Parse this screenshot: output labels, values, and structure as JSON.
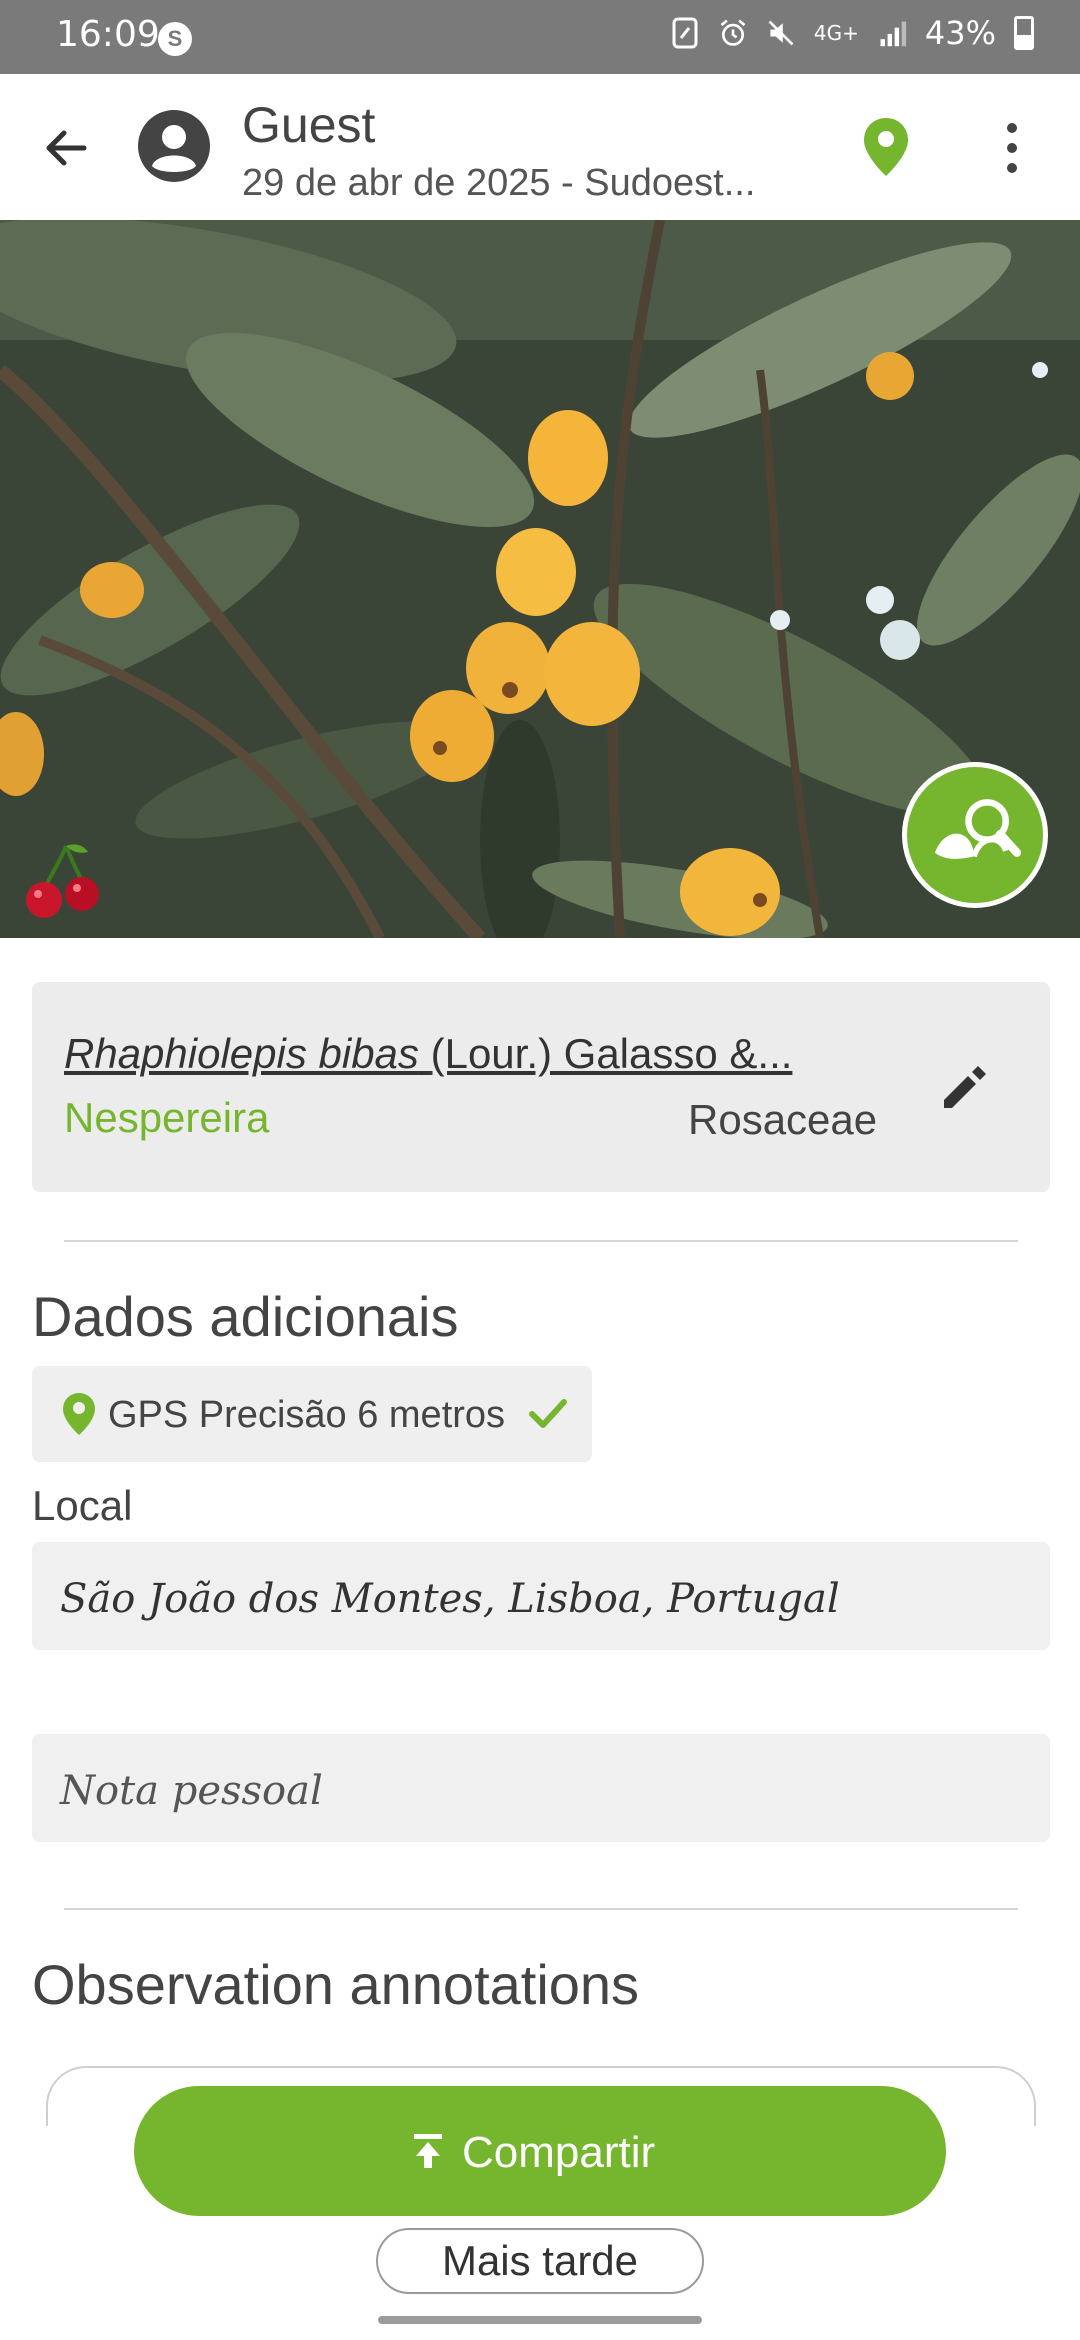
{
  "status_bar": {
    "time": "16:09",
    "badge": "S",
    "battery": "43%",
    "network": "4G+"
  },
  "app_bar": {
    "title": "Guest",
    "subtitle": "29 de abr de 2025 - Sudoest..."
  },
  "taxon": {
    "scientific_name": "Rhaphiolepis bibas",
    "authority": "(Lour.) Galasso &...",
    "common_name": "Nespereira",
    "family": "Rosaceae"
  },
  "additional": {
    "title": "Dados adicionais",
    "gps_text": "GPS Precisão 6 metros",
    "location_label": "Local",
    "location_value": "São João dos Montes, Lisboa, Portugal",
    "note_placeholder": "Nota pessoal"
  },
  "annotations": {
    "title": "Observation annotations"
  },
  "actions": {
    "share_label": "Compartir",
    "later_label": "Mais tarde"
  },
  "colors": {
    "accent": "#76b62e",
    "status_bar": "#7a7a7a",
    "card_bg": "#ececec"
  },
  "icons": [
    "back-arrow-icon",
    "account-icon",
    "location-pin-icon",
    "more-vert-icon",
    "plant-search-icon",
    "cherry-icon",
    "edit-pencil-icon",
    "check-icon",
    "upload-icon"
  ]
}
